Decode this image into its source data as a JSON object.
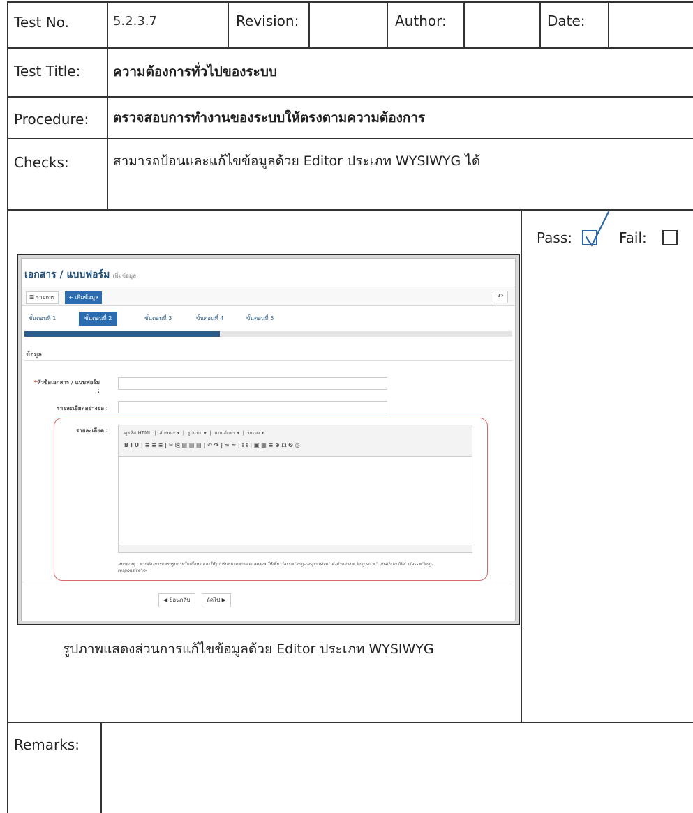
{
  "form": {
    "test_no_label": "Test No.",
    "test_no_value": "5.2.3.7",
    "revision_label": "Revision:",
    "author_label": "Author:",
    "date_label": "Date:",
    "test_title_label": "Test Title:",
    "test_title_value": "ความต้องการทั่วไปของระบบ",
    "procedure_label": "Procedure:",
    "procedure_value": "ตรวจสอบการทำงานของระบบให้ตรงตามความต้องการ",
    "checks_label": "Checks:",
    "checks_value": "สามารถป้อนและแก้ไขข้อมูลด้วย Editor ประเภท WYSIWYG ได้",
    "pass_label": "Pass:",
    "fail_label": "Fail:",
    "pass_checked": true,
    "fail_checked": false,
    "caption": "รูปภาพแสดงส่วนการแก้ไขข้อมูลด้วย Editor ประเภท WYSIWYG",
    "remarks_label": "Remarks:"
  },
  "screenshot": {
    "title": "เอกสาร / แบบฟอร์ม",
    "subtitle": "เพิ่มข้อมูล",
    "list_button": "รายการ",
    "add_button": "เพิ่มข้อมูล",
    "steps": [
      "ขั้นตอนที่ 1",
      "ขั้นตอนที่ 2",
      "ขั้นตอนที่ 3",
      "ขั้นตอนที่ 4",
      "ขั้นตอนที่ 5"
    ],
    "active_step": 2,
    "progress_fraction": 0.4,
    "section_label": "ข้อมูล",
    "field_title_label": "หัวข้อเอกสาร / แบบฟอร์ม :",
    "field_summary_label": "รายละเอียดอย่างย่อ :",
    "field_detail_label": "รายละเอียด :",
    "editor_toolbar_row1": [
      "ดูรหัส HTML",
      "ลักษณะ",
      "รูปแบบ",
      "แบบอักษร",
      "ขนาด"
    ],
    "editor_toolbar_row2": "B  I  U  |  ≡  ≡  ≡  |  ✂  ⎘  ▤  ▤  ▤  |  ↶  ↷  |  ∞  ≈  |  ⁝  ⁝  |  ▣  ▦  ≡  ⊕  Ω  ❷  ◎",
    "note": "หมายเหตุ : หากต้องการแทรกรูปภาพในเนื้อหา และให้รูปปรับขนาดตามจอแสดงผล ให้เพิ่ม class=\"img-responsive\" ดังตัวอย่าง < img src=\"../path to file\" class=\"img-responsive\"/>",
    "back_button": "ย้อนกลับ",
    "next_button": "ถัดไป"
  }
}
